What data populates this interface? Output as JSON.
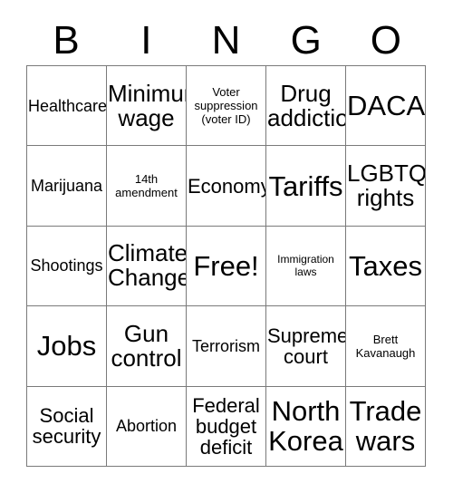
{
  "card": {
    "header_letters": [
      "B",
      "I",
      "N",
      "G",
      "O"
    ],
    "rows": [
      [
        {
          "text": "Healthcare",
          "size": "fs-md"
        },
        {
          "text": "Minimum\nwage",
          "size": "fs-xl"
        },
        {
          "text": "Voter\nsuppression\n(voter ID)",
          "size": "fs-xs"
        },
        {
          "text": "Drug\naddiction",
          "size": "fs-xl"
        },
        {
          "text": "DACA",
          "size": "fs-xxl"
        }
      ],
      [
        {
          "text": "Marijuana",
          "size": "fs-md"
        },
        {
          "text": "14th\namendment",
          "size": "fs-xs"
        },
        {
          "text": "Economy",
          "size": "fs-lg"
        },
        {
          "text": "Tariffs",
          "size": "fs-xxl"
        },
        {
          "text": "LGBTQ\nrights",
          "size": "fs-xl"
        }
      ],
      [
        {
          "text": "Shootings",
          "size": "fs-md"
        },
        {
          "text": "Climate\nChange",
          "size": "fs-xl"
        },
        {
          "text": "Free!",
          "size": "fs-xxl"
        },
        {
          "text": "Immigration\nlaws",
          "size": "fs-xxs"
        },
        {
          "text": "Taxes",
          "size": "fs-xxl"
        }
      ],
      [
        {
          "text": "Jobs",
          "size": "fs-xxl"
        },
        {
          "text": "Gun\ncontrol",
          "size": "fs-xl"
        },
        {
          "text": "Terrorism",
          "size": "fs-md"
        },
        {
          "text": "Supreme\ncourt",
          "size": "fs-lg"
        },
        {
          "text": "Brett\nKavanaugh",
          "size": "fs-xs"
        }
      ],
      [
        {
          "text": "Social\nsecurity",
          "size": "fs-lg"
        },
        {
          "text": "Abortion",
          "size": "fs-md"
        },
        {
          "text": "Federal\nbudget\ndeficit",
          "size": "fs-lg"
        },
        {
          "text": "North\nKorea",
          "size": "fs-xxl"
        },
        {
          "text": "Trade\nwars",
          "size": "fs-xxl"
        }
      ]
    ]
  }
}
